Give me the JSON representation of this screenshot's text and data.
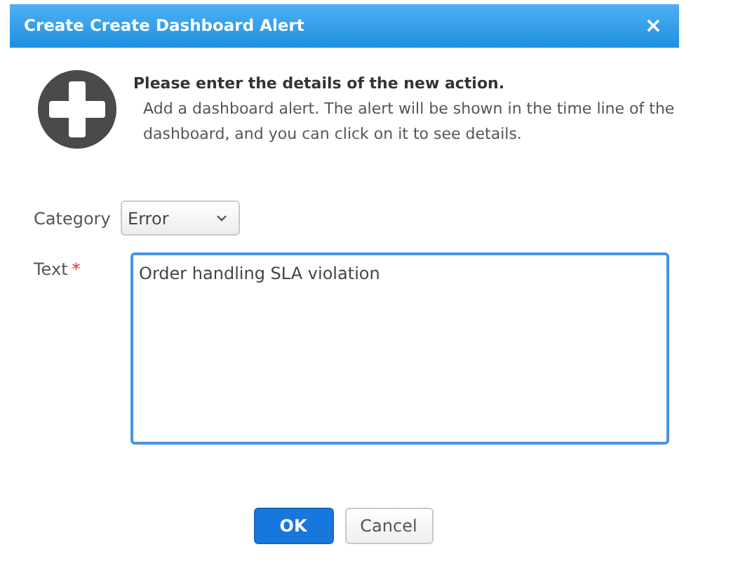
{
  "window": {
    "title": "Create Create Dashboard Alert",
    "close": "×"
  },
  "header": {
    "heading": "Please enter the details of the new action.",
    "description": "Add a dashboard alert. The alert will be shown in the time line of the dashboard, and you can click on it to see details."
  },
  "fields": [
    {
      "kind": "select",
      "label": "Category",
      "value": "Error"
    },
    {
      "kind": "textarea",
      "label": "Text",
      "value": "Order handling SLA violation",
      "required_mark": "*",
      "focused": true
    }
  ],
  "buttons": [
    {
      "label": "OK",
      "primary": true
    },
    {
      "label": "Cancel",
      "primary": false
    }
  ]
}
